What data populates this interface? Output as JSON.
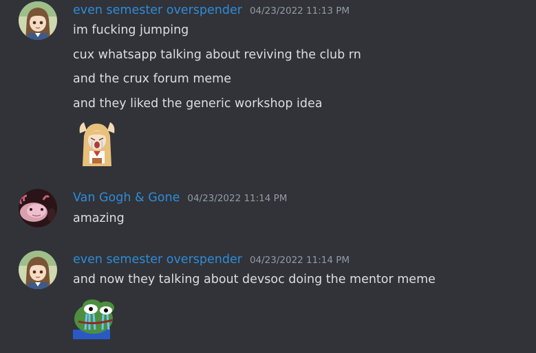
{
  "messages": [
    {
      "username": "even semester overspender",
      "timestamp": "04/23/2022 11:13 PM",
      "avatar_icon": "anime-girl-avatar",
      "lines": [
        "im fucking jumping",
        "cux whatsapp talking about reviving the club rn",
        "and the crux forum meme",
        "and they liked the generic workshop idea"
      ],
      "sticker_icon": "anime-girl-crying-emoji"
    },
    {
      "username": "Van Gogh & Gone",
      "timestamp": "04/23/2022 11:14 PM",
      "avatar_icon": "axolotl-avatar",
      "lines": [
        "amazing"
      ]
    },
    {
      "username": "even semester overspender",
      "timestamp": "04/23/2022 11:14 PM",
      "avatar_icon": "anime-girl-avatar",
      "lines": [
        "and now they talking about devsoc doing the mentor meme"
      ],
      "sticker_icon": "pepe-crying-emoji"
    }
  ],
  "colors": {
    "background": "#313338",
    "username": "#2f8bd8",
    "timestamp": "#949ba4",
    "text": "#dbdee1"
  }
}
